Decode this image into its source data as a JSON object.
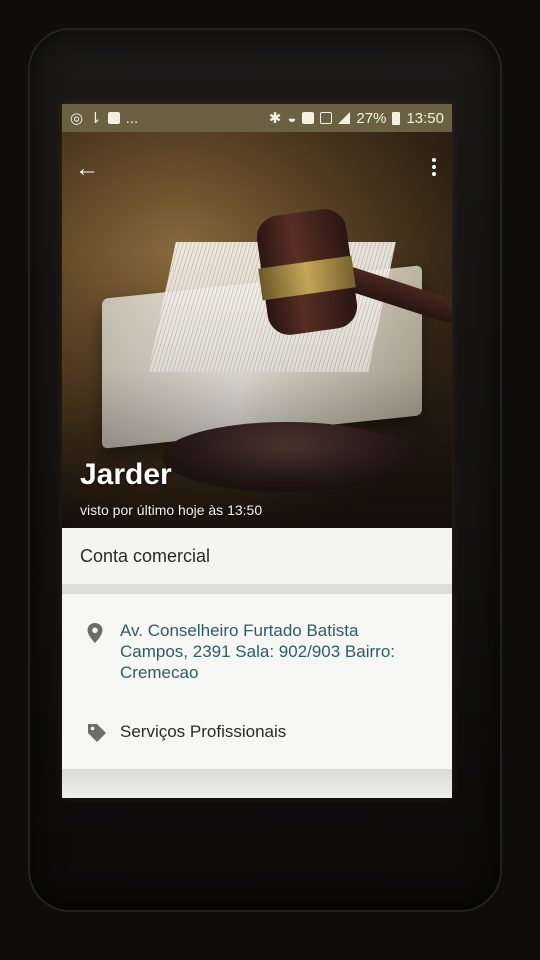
{
  "status_bar": {
    "left_icons": [
      "whatsapp-icon",
      "sim-icon",
      "facebook-icon"
    ],
    "ellipsis": "...",
    "battery": "27%",
    "time": "13:50"
  },
  "header": {
    "contact_name": "Jarder",
    "last_seen": "visto por último hoje às 13:50"
  },
  "business": {
    "label": "Conta comercial"
  },
  "details": {
    "address": "Av. Conselheiro Furtado Batista Campos, 2391 Sala: 902/903 Bairro: Cremecao",
    "category": "Serviços Profissionais"
  },
  "colors": {
    "status_bar_bg": "#6b6042",
    "address_text": "#2c5f62"
  }
}
